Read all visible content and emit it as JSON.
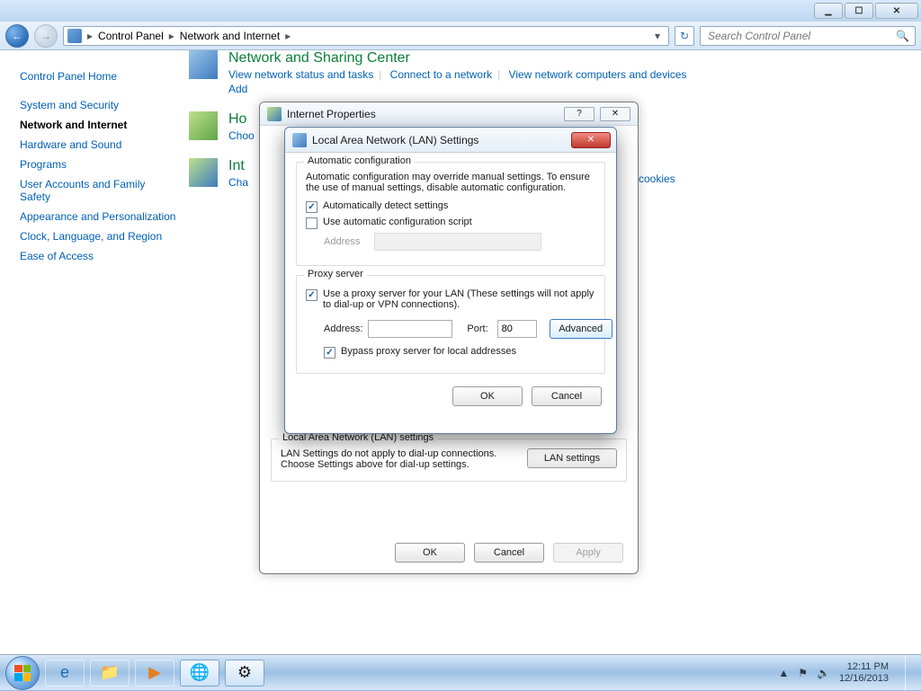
{
  "chrome": {
    "min_icon": "minimize",
    "max_icon": "maximize",
    "close_icon": "close"
  },
  "nav": {
    "back_arrow": "←",
    "fwd_arrow": "→",
    "bc_root": "▸",
    "bc1": "Control Panel",
    "bc2": "Network and Internet",
    "sep": "▸",
    "refresh": "↻",
    "search_placeholder": "Search Control Panel"
  },
  "sidebar": {
    "home": "Control Panel Home",
    "items": [
      "System and Security",
      "Network and Internet",
      "Hardware and Sound",
      "Programs",
      "User Accounts and Family Safety",
      "Appearance and Personalization",
      "Clock, Language, and Region",
      "Ease of Access"
    ]
  },
  "content": {
    "nsc": {
      "title": "Network and Sharing Center",
      "l1": "View network status and tasks",
      "l2": "Connect to a network",
      "l3": "View network computers and devices",
      "l4": "Add"
    },
    "homegroup_title_frag": "Ho",
    "homegroup_sub_frag": "Choo",
    "internet_title_frag": "Int",
    "internet_sub_frag": "Cha",
    "internet_tail": "d cookies"
  },
  "ip": {
    "title": "Internet Properties",
    "help_icon": "?",
    "close_icon": "✕",
    "lan_group_legend": "Local Area Network (LAN) settings",
    "lan_group_text": "LAN Settings do not apply to dial-up connections. Choose Settings above for dial-up settings.",
    "lan_settings_btn": "LAN settings",
    "ok": "OK",
    "cancel": "Cancel",
    "apply": "Apply"
  },
  "lan": {
    "title": "Local Area Network (LAN) Settings",
    "close_icon": "✕",
    "auto_legend": "Automatic configuration",
    "auto_text": "Automatic configuration may override manual settings.  To ensure the use of manual settings, disable automatic configuration.",
    "chk_auto_detect": "Automatically detect settings",
    "chk_auto_script": "Use automatic configuration script",
    "address_label": "Address",
    "proxy_legend": "Proxy server",
    "proxy_text": "Use a proxy server for your LAN (These settings will not apply to dial-up or VPN connections).",
    "addr2_label": "Address:",
    "port_label": "Port:",
    "port_value": "80",
    "advanced": "Advanced",
    "bypass": "Bypass proxy server for local addresses",
    "ok": "OK",
    "cancel": "Cancel"
  },
  "taskbar": {
    "ie_icon": "e",
    "explorer_icon": "📁",
    "wmp_icon": "▶",
    "net_icon": "🌐",
    "cp_icon": "⚙",
    "tray_up": "▲",
    "tray_flag": "⚑",
    "tray_vol": "🔈",
    "time": "12:11 PM",
    "date": "12/16/2013"
  }
}
